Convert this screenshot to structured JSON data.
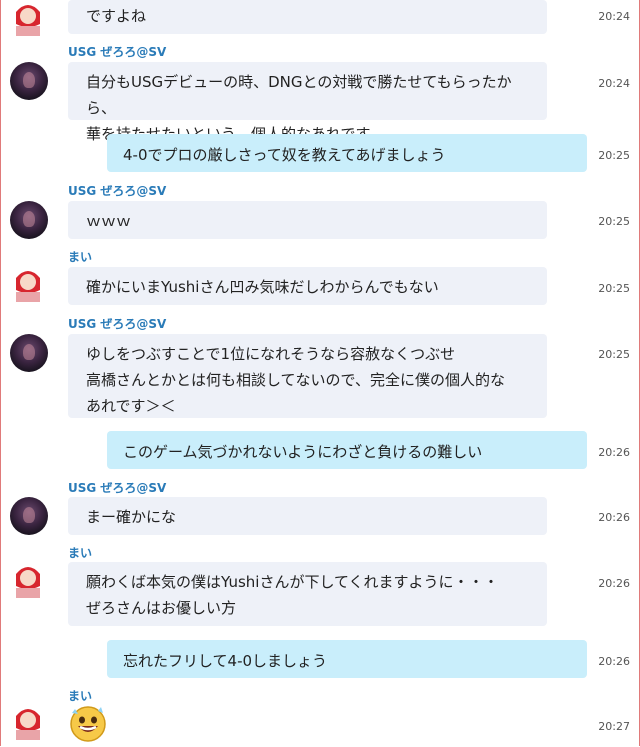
{
  "messages": [
    {
      "sender": "",
      "avatar": "mai",
      "text": "ですよね",
      "time": "20:24",
      "me": false
    },
    {
      "sender": "USG ぜろろ@SV",
      "avatar": "zero",
      "text": "自分もUSGデビューの時、DNGとの対戦で勝たせてもらったから、\n華を持たせたいという　個人的なあれです",
      "time": "20:24",
      "me": false
    },
    {
      "sender": "",
      "avatar": "",
      "text": "4-0でプロの厳しさって奴を教えてあげましょう",
      "time": "20:25",
      "me": true
    },
    {
      "sender": "USG ぜろろ@SV",
      "avatar": "zero",
      "text": "ｗｗｗ",
      "time": "20:25",
      "me": false
    },
    {
      "sender": "まい",
      "avatar": "mai",
      "text": "確かにいまYushiさん凹み気味だしわからんでもない",
      "time": "20:25",
      "me": false
    },
    {
      "sender": "USG ぜろろ@SV",
      "avatar": "zero",
      "text": "ゆしをつぶすことで1位になれそうなら容赦なくつぶせ\n高橋さんとかとは何も相談してないので、完全に僕の個人的な\nあれです＞＜",
      "time": "20:25",
      "me": false
    },
    {
      "sender": "",
      "avatar": "",
      "text": "このゲーム気づかれないようにわざと負けるの難しい",
      "time": "20:26",
      "me": true
    },
    {
      "sender": "USG ぜろろ@SV",
      "avatar": "zero",
      "text": "まー確かにな",
      "time": "20:26",
      "me": false
    },
    {
      "sender": "まい",
      "avatar": "mai",
      "text": "願わくば本気の僕はYushiさんが下してくれますように・・・\nぜろさんはお優しい方",
      "time": "20:26",
      "me": false
    },
    {
      "sender": "",
      "avatar": "",
      "text": "忘れたフリして4-0しましょう",
      "time": "20:26",
      "me": true
    },
    {
      "sender": "まい",
      "avatar": "mai",
      "text": "",
      "time": "20:27",
      "me": false,
      "emoji": "grinning-sweat-emoji"
    }
  ]
}
